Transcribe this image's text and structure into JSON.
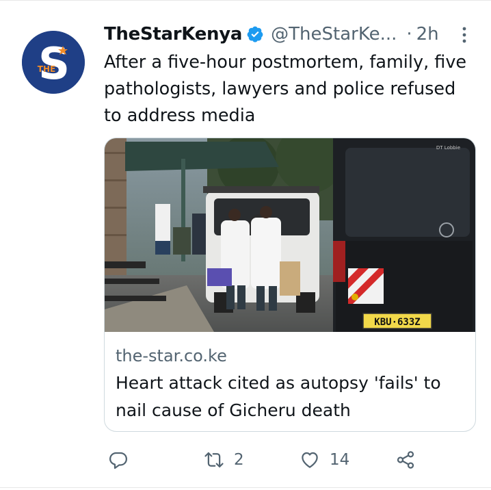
{
  "tweet": {
    "author": {
      "display_name": "TheStarKenya",
      "handle": "@TheStarKe...",
      "avatar_text": "THE"
    },
    "separator": "·",
    "time": "2h",
    "text": "After a five-hour postmortem, family, five pathologists, lawyers and police refused to address media"
  },
  "card": {
    "domain": "the-star.co.ke",
    "title": "Heart attack cited as autopsy 'fails' to nail cause of Gicheru death",
    "image_texts": {
      "vehicle_plate": "KBU·633Z",
      "window_sticker": "DT Lobbie"
    }
  },
  "actions": {
    "reply_count": "",
    "retweet_count": "2",
    "like_count": "14"
  },
  "colors": {
    "verified_blue": "#1d9bf0",
    "secondary_text": "#536471",
    "brand_navy": "#1f3f86",
    "brand_orange": "#f28c28"
  },
  "icons": [
    "verified-badge-icon",
    "more-icon",
    "reply-icon",
    "retweet-icon",
    "like-icon",
    "share-icon"
  ]
}
